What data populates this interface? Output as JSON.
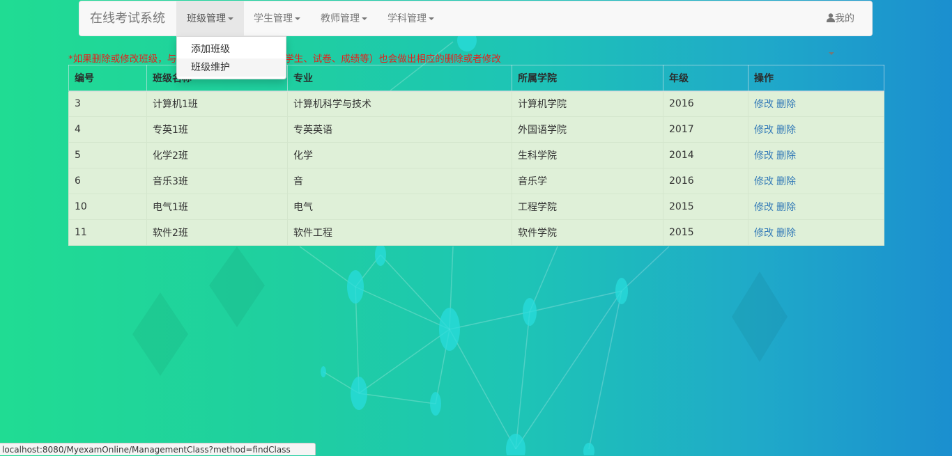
{
  "navbar": {
    "brand": "在线考试系统",
    "menus": [
      {
        "label": "班级管理"
      },
      {
        "label": "学生管理"
      },
      {
        "label": "教师管理"
      },
      {
        "label": "学科管理"
      }
    ],
    "user_label": "我的"
  },
  "dropdown": {
    "items": [
      {
        "label": "添加班级"
      },
      {
        "label": "班级维护"
      }
    ]
  },
  "notice": {
    "left": "*如果删除或修改班级，与",
    "right": "班的学生、试卷、成绩等）也会做出相应的删除或者修改"
  },
  "table": {
    "headers": [
      "编号",
      "班级名称",
      "专业",
      "所属学院",
      "年级",
      "操作"
    ],
    "rows": [
      {
        "id": "3",
        "name": "计算机1班",
        "major": "计算机科学与技术",
        "college": "计算机学院",
        "grade": "2016"
      },
      {
        "id": "4",
        "name": "专英1班",
        "major": "专英英语",
        "college": "外国语学院",
        "grade": "2017"
      },
      {
        "id": "5",
        "name": "化学2班",
        "major": "化学",
        "college": "生科学院",
        "grade": "2014"
      },
      {
        "id": "6",
        "name": "音乐3班",
        "major": "音",
        "college": "音乐学",
        "grade": "2016"
      },
      {
        "id": "10",
        "name": "电气1班",
        "major": "电气",
        "college": "工程学院",
        "grade": "2015"
      },
      {
        "id": "11",
        "name": "软件2班",
        "major": "软件工程",
        "college": "软件学院",
        "grade": "2015"
      }
    ],
    "edit_label": "修改",
    "delete_label": "删除"
  },
  "statusbar": {
    "url": "localhost:8080/MyexamOnline/ManagementClass?method=findClass"
  },
  "icons": {
    "user": "user-icon",
    "caret": "caret-down-icon"
  },
  "colors": {
    "notice": "#e4211c",
    "link": "#337ab7",
    "row_bg": "#dff0d8"
  }
}
